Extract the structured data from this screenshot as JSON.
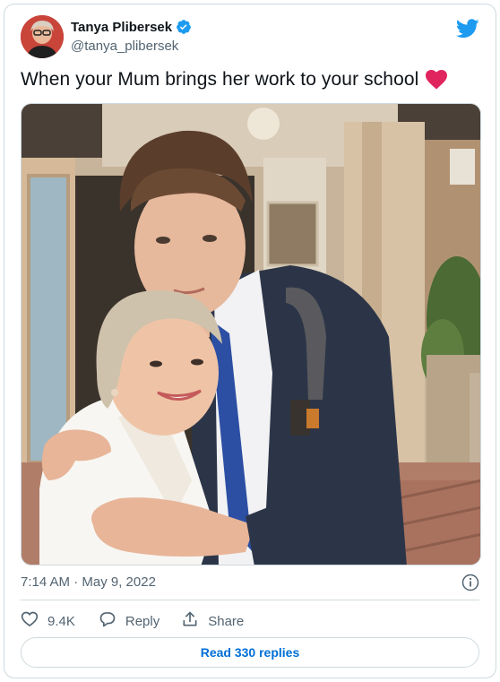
{
  "author": {
    "name": "Tanya Plibersek",
    "handle": "@tanya_plibersek",
    "verified_icon": "verified-badge-icon",
    "avatar_icon": "avatar"
  },
  "brand": {
    "logo_icon": "twitter-bird-icon",
    "color": "#1d9bf0"
  },
  "tweet": {
    "text": "When your Mum brings her work to your school",
    "emoji": "red-heart-icon",
    "photo_icon": "tweet-photo"
  },
  "meta": {
    "timestamp": "7:14 AM · May 9, 2022",
    "info_icon": "info-icon"
  },
  "actions": {
    "like": {
      "icon": "heart-outline-icon",
      "count": "9.4K"
    },
    "reply": {
      "icon": "speech-bubble-icon",
      "label": "Reply"
    },
    "share": {
      "icon": "share-upload-icon",
      "label": "Share"
    }
  },
  "replies": {
    "label": "Read 330 replies",
    "color": "#006fd6"
  },
  "colors": {
    "text": "#0f1419",
    "secondary": "#536471",
    "border": "#cfd9de",
    "heart": "#e0245e"
  }
}
